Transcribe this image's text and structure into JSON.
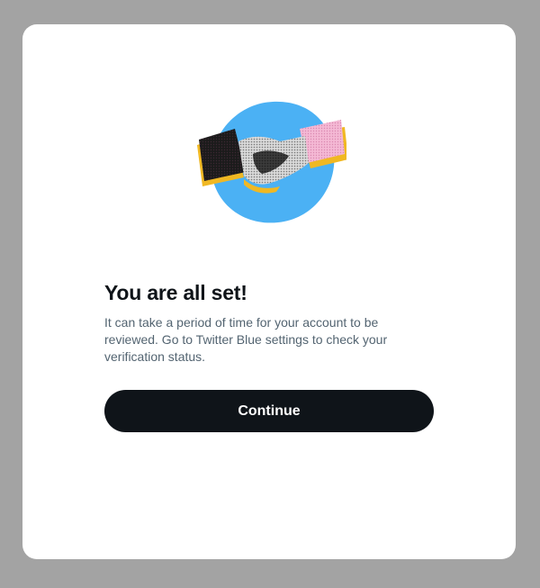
{
  "modal": {
    "title": "You are all set!",
    "description": "It can take a period of time for your account to be reviewed. Go to Twitter Blue settings to check your verification status.",
    "continue_label": "Continue",
    "illustration": {
      "icon": "handshake-illustration",
      "circle_color": "#4bb1f4",
      "sleeve_left_color": "#1a1a1a",
      "sleeve_right_color": "#f4b8d4",
      "shadow_color": "#f0b823"
    }
  },
  "colors": {
    "overlay": "#a3a3a3",
    "button": "#0f1419",
    "title": "#0f1419",
    "text": "#536471"
  }
}
